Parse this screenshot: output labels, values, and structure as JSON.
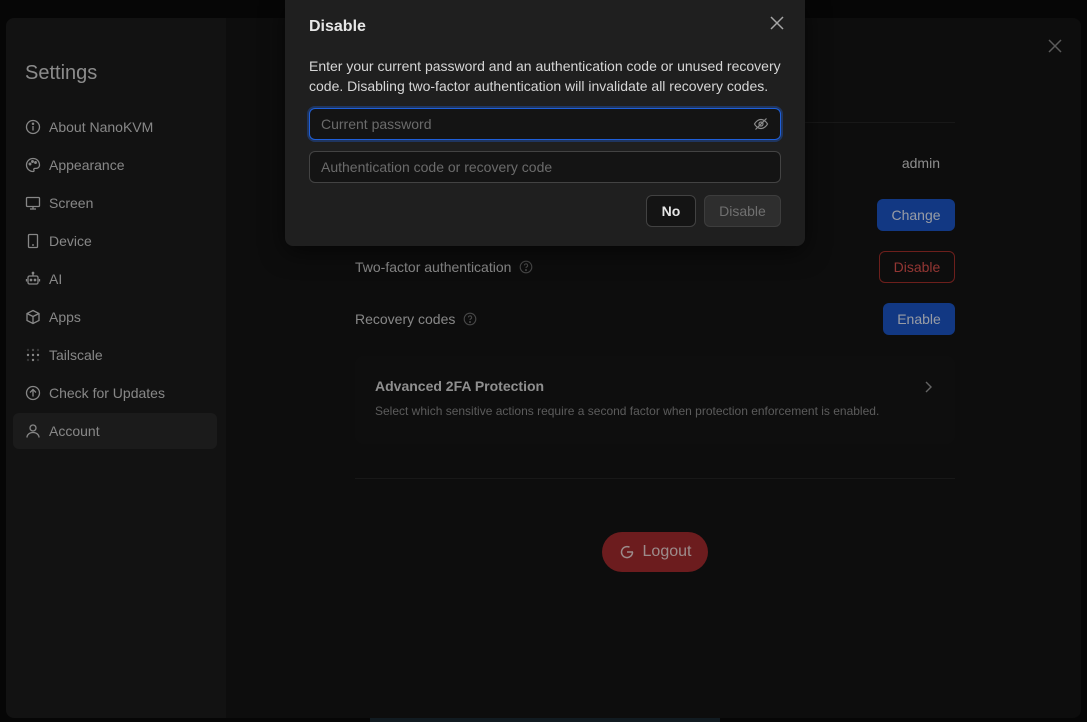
{
  "settings": {
    "title": "Settings",
    "nav": [
      {
        "label": "About NanoKVM",
        "icon": "info-circle-icon"
      },
      {
        "label": "Appearance",
        "icon": "palette-icon"
      },
      {
        "label": "Screen",
        "icon": "monitor-icon"
      },
      {
        "label": "Device",
        "icon": "tablet-icon"
      },
      {
        "label": "AI",
        "icon": "robot-icon"
      },
      {
        "label": "Apps",
        "icon": "box-icon"
      },
      {
        "label": "Tailscale",
        "icon": "tailscale-dots-icon"
      },
      {
        "label": "Check for Updates",
        "icon": "arrow-up-circle-icon"
      },
      {
        "label": "Account",
        "icon": "user-icon"
      }
    ],
    "active_nav": "Account"
  },
  "account": {
    "username_value": "admin",
    "change_button": "Change",
    "two_factor_label": "Two-factor authentication",
    "two_factor_button": "Disable",
    "recovery_label": "Recovery codes",
    "recovery_button": "Enable",
    "advanced": {
      "title": "Advanced 2FA Protection",
      "description": "Select which sensitive actions require a second factor when protection enforcement is enabled."
    },
    "logout_button": "Logout"
  },
  "modal": {
    "title": "Disable",
    "description": "Enter your current password and an authentication code or unused recovery code. Disabling two-factor authentication will invalidate all recovery codes.",
    "password_placeholder": "Current password",
    "password_value": "",
    "code_placeholder": "Authentication code or recovery code",
    "code_value": "",
    "no_button": "No",
    "disable_button": "Disable"
  },
  "colors": {
    "primary": "#1c57c9",
    "danger": "#a72c2e",
    "focus": "#1f5fd8"
  }
}
